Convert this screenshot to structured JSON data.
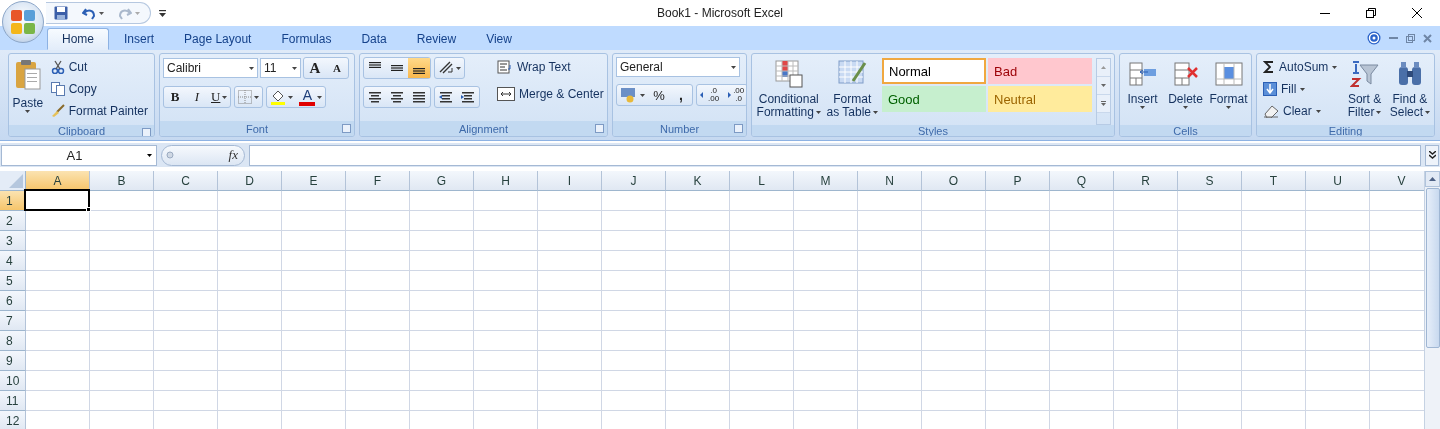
{
  "window": {
    "title": "Book1 - Microsoft Excel"
  },
  "tabs": [
    {
      "label": "Home",
      "selected": true
    },
    {
      "label": "Insert",
      "selected": false
    },
    {
      "label": "Page Layout",
      "selected": false
    },
    {
      "label": "Formulas",
      "selected": false
    },
    {
      "label": "Data",
      "selected": false
    },
    {
      "label": "Review",
      "selected": false
    },
    {
      "label": "View",
      "selected": false
    }
  ],
  "clipboard": {
    "label": "Clipboard",
    "paste": "Paste",
    "cut": "Cut",
    "copy": "Copy",
    "format_painter": "Format Painter"
  },
  "font": {
    "label": "Font",
    "font_name": "Calibri",
    "font_size": "11",
    "grow": "A",
    "shrink": "A",
    "bold": "B",
    "italic": "I",
    "underline": "U",
    "font_color": "A"
  },
  "alignment": {
    "label": "Alignment",
    "wrap_text": "Wrap Text",
    "merge_center": "Merge & Center",
    "vertical": [
      {
        "selected": false
      },
      {
        "selected": false
      },
      {
        "selected": true
      }
    ]
  },
  "number": {
    "label": "Number",
    "format": "General",
    "percent": "%",
    "comma": ",",
    "increase_decimal": {
      "top": ".0",
      "bottom": ".00"
    },
    "decrease_decimal": {
      "top": ".00",
      "bottom": ".0"
    }
  },
  "styles": {
    "label": "Styles",
    "conditional": [
      "Conditional",
      "Formatting"
    ],
    "format_table": [
      "Format",
      "as Table"
    ],
    "cell_styles": [
      {
        "name": "Normal",
        "color": "#ffffff",
        "selected": true
      },
      {
        "name": "Bad",
        "color": "#ffc7ce",
        "selected": false
      },
      {
        "name": "Good",
        "color": "#c6efce",
        "selected": false
      },
      {
        "name": "Neutral",
        "color": "#ffeb9c",
        "selected": false
      }
    ]
  },
  "cells": {
    "label": "Cells",
    "buttons": [
      {
        "kind": "insert",
        "label": "Insert"
      },
      {
        "kind": "delete",
        "label": "Delete"
      },
      {
        "kind": "format",
        "label": "Format"
      }
    ]
  },
  "editing": {
    "label": "Editing",
    "autosum": "AutoSum",
    "fill": "Fill",
    "clear": "Clear",
    "sort_filter": [
      "Sort &",
      "Filter"
    ],
    "find_select": [
      "Find &",
      "Select"
    ]
  },
  "formula_bar": {
    "name_box": "A1",
    "fx": "fx"
  },
  "sheet": {
    "columns": [
      {
        "label": "A",
        "selected": true
      },
      {
        "label": "B",
        "selected": false
      },
      {
        "label": "C",
        "selected": false
      },
      {
        "label": "D",
        "selected": false
      },
      {
        "label": "E",
        "selected": false
      },
      {
        "label": "F",
        "selected": false
      },
      {
        "label": "G",
        "selected": false
      },
      {
        "label": "H",
        "selected": false
      },
      {
        "label": "I",
        "selected": false
      },
      {
        "label": "J",
        "selected": false
      },
      {
        "label": "K",
        "selected": false
      },
      {
        "label": "L",
        "selected": false
      },
      {
        "label": "M",
        "selected": false
      },
      {
        "label": "N",
        "selected": false
      },
      {
        "label": "O",
        "selected": false
      },
      {
        "label": "P",
        "selected": false
      },
      {
        "label": "Q",
        "selected": false
      },
      {
        "label": "R",
        "selected": false
      },
      {
        "label": "S",
        "selected": false
      },
      {
        "label": "T",
        "selected": false
      },
      {
        "label": "U",
        "selected": false
      },
      {
        "label": "V",
        "selected": false
      }
    ],
    "rows": [
      {
        "label": "1",
        "selected": true
      },
      {
        "label": "2",
        "selected": false
      },
      {
        "label": "3",
        "selected": false
      },
      {
        "label": "4",
        "selected": false
      },
      {
        "label": "5",
        "selected": false
      },
      {
        "label": "6",
        "selected": false
      },
      {
        "label": "7",
        "selected": false
      },
      {
        "label": "8",
        "selected": false
      },
      {
        "label": "9",
        "selected": false
      },
      {
        "label": "10",
        "selected": false
      },
      {
        "label": "11",
        "selected": false
      },
      {
        "label": "12",
        "selected": false
      }
    ]
  }
}
